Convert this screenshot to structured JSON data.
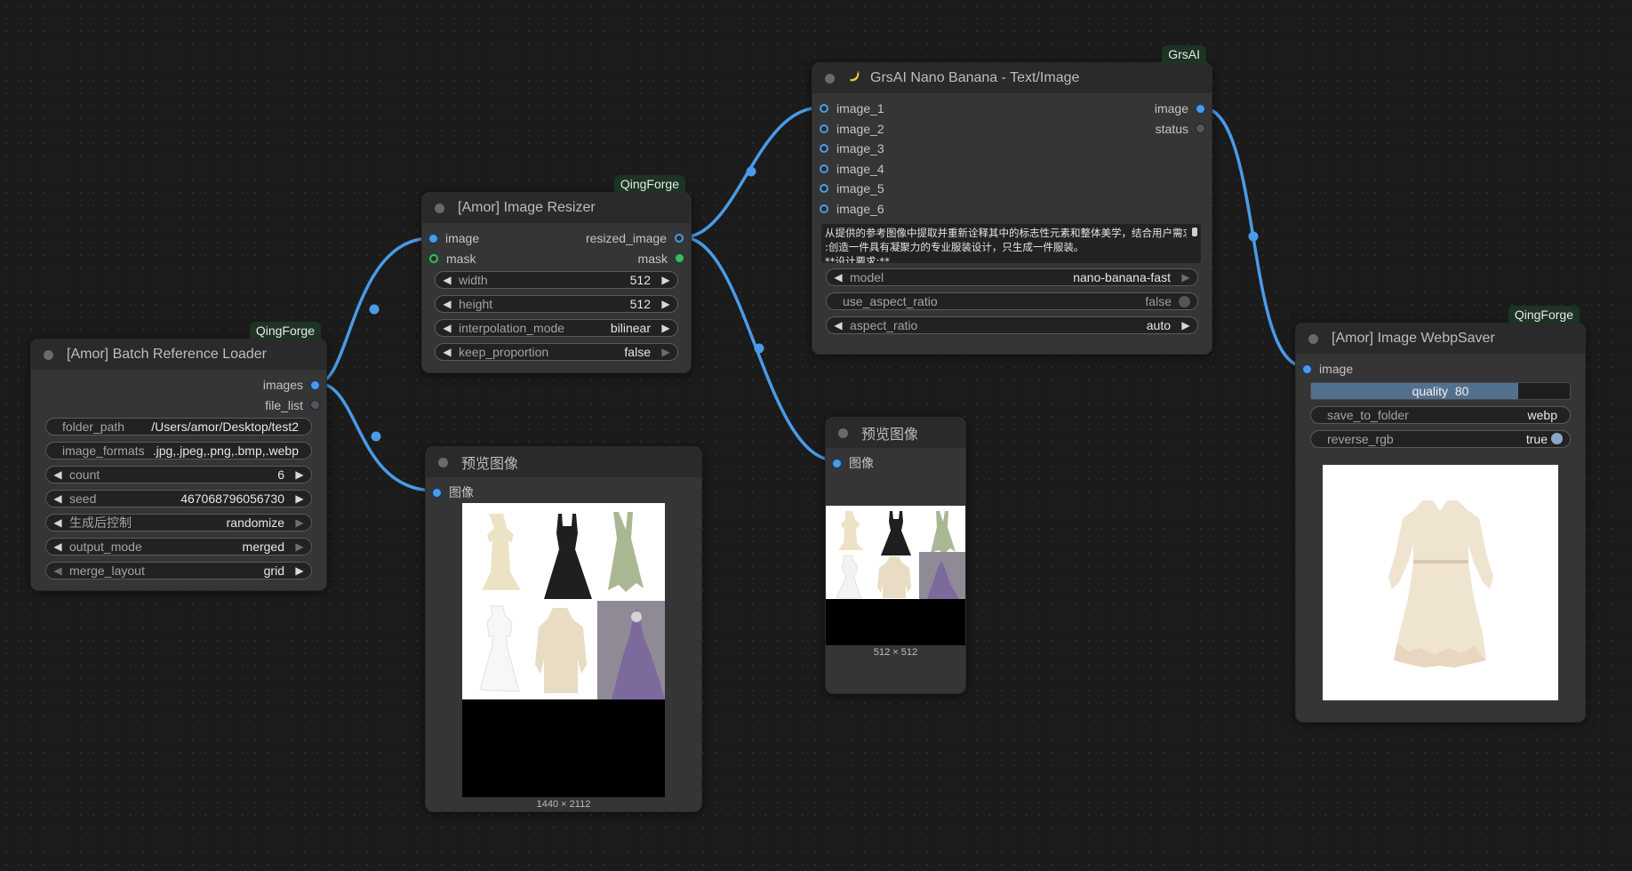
{
  "nodes": {
    "loader": {
      "badge": "QingForge",
      "title": "[Amor] Batch Reference Loader",
      "outputs": [
        "images",
        "file_list"
      ],
      "widgets": {
        "folder_path": {
          "label": "folder_path",
          "value": "/Users/amor/Desktop/test2"
        },
        "image_formats": {
          "label": "image_formats",
          "value": ".jpg,.jpeg,.png,.bmp,.webp"
        },
        "count": {
          "label": "count",
          "value": "6"
        },
        "seed": {
          "label": "seed",
          "value": "467068796056730"
        },
        "control_after": {
          "label": "生成后控制",
          "value": "randomize"
        },
        "output_mode": {
          "label": "output_mode",
          "value": "merged"
        },
        "merge_layout": {
          "label": "merge_layout",
          "value": "grid"
        }
      }
    },
    "resizer": {
      "badge": "QingForge",
      "title": "[Amor] Image Resizer",
      "inputs": [
        "image",
        "mask"
      ],
      "outputs": [
        "resized_image",
        "mask"
      ],
      "widgets": {
        "width": {
          "label": "width",
          "value": "512"
        },
        "height": {
          "label": "height",
          "value": "512"
        },
        "interpolation_mode": {
          "label": "interpolation_mode",
          "value": "bilinear"
        },
        "keep_proportion": {
          "label": "keep_proportion",
          "value": "false"
        }
      }
    },
    "preview1": {
      "title": "预览图像",
      "input": "图像",
      "caption": "1440 × 2112"
    },
    "nano": {
      "badge": "GrsAI",
      "icon": "banana-icon",
      "title": "GrsAI Nano Banana - Text/Image",
      "inputs": [
        "image_1",
        "image_2",
        "image_3",
        "image_4",
        "image_5",
        "image_6"
      ],
      "outputs": [
        "image",
        "status"
      ],
      "prompt_lines": [
        "从提供的参考图像中提取并重新诠释其中的标志性元素和整体美学，结合用户需求",
        ":创造一件具有凝聚力的专业服装设计，只生成一件服装。",
        "**设计要求:**"
      ],
      "widgets": {
        "model": {
          "label": "model",
          "value": "nano-banana-fast"
        },
        "use_aspect_ratio": {
          "label": "use_aspect_ratio",
          "value": "false"
        },
        "aspect_ratio": {
          "label": "aspect_ratio",
          "value": "auto"
        }
      }
    },
    "preview2": {
      "title": "预览图像",
      "input": "图像",
      "caption": "512 × 512"
    },
    "saver": {
      "badge": "QingForge",
      "title": "[Amor] Image WebpSaver",
      "input": "image",
      "widgets": {
        "quality": {
          "label": "quality",
          "value": "80",
          "fraction": 0.8
        },
        "save_to_folder": {
          "label": "save_to_folder",
          "value": "webp"
        },
        "reverse_rgb": {
          "label": "reverse_rgb",
          "value": "true"
        }
      }
    }
  },
  "colors": {
    "canvas": "#1b1b1b",
    "node_body": "#353535",
    "node_header": "#2a2a2a",
    "link_image": "#4a9be8",
    "link_mask": "#3bb864",
    "badge_bg": "#1d3323"
  }
}
